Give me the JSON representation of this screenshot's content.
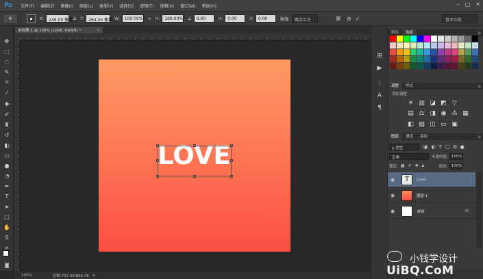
{
  "app": {
    "logo": "Ps"
  },
  "menu": [
    "文件(F)",
    "编辑(E)",
    "图像(I)",
    "图层(L)",
    "类型(Y)",
    "选择(S)",
    "滤镜(T)",
    "视图(V)",
    "窗口(W)",
    "帮助(H)"
  ],
  "window_controls": [
    "–",
    "□",
    "✕"
  ],
  "options": {
    "x_label": "X:",
    "x_value": "249.00 像素",
    "y_label": "Y:",
    "y_value": "264.45 像素",
    "w_label": "W:",
    "w_value": "100.00%",
    "h_label": "H:",
    "h_value": "100.00%",
    "angle_value": "0.00",
    "hskew_label": "H:",
    "hskew_value": "0.00",
    "vskew_label": "V:",
    "vskew_value": "0.00",
    "interp_label": "插值:",
    "interp_value": "两次立方",
    "workspace": "基本功能"
  },
  "document": {
    "tab_title": "未标题-1 @ 100% (LOVE, RGB/8) *",
    "tab_close": "×"
  },
  "canvas": {
    "text": "LOVE"
  },
  "status": {
    "zoom": "100%",
    "doc_info": "文档:732.4K/865.4K"
  },
  "panels": {
    "color_tabs": [
      "颜色",
      "色板"
    ],
    "adjust_tabs": [
      "调整",
      "样式"
    ],
    "adjust_label": "添加调整",
    "layer_tabs": [
      "图层",
      "通道",
      "路径"
    ],
    "kind_select": "ρ 类型",
    "blend_mode": "正常",
    "opacity_label": "不透明度:",
    "opacity_value": "100%",
    "lock_label": "锁定:",
    "fill_label": "填充:",
    "fill_value": "100%",
    "layers": [
      {
        "name": "Love",
        "thumb": "T",
        "selected": true
      },
      {
        "name": "图层 1",
        "thumb": "",
        "selected": false
      },
      {
        "name": "背景",
        "thumb": "",
        "selected": false
      }
    ]
  },
  "swatch_colors": [
    "#ff0000",
    "#ffff00",
    "#00ff00",
    "#00ffff",
    "#0000ff",
    "#ff00ff",
    "#ffffff",
    "#e6e6e6",
    "#cccccc",
    "#b3b3b3",
    "#999999",
    "#666666",
    "#000000",
    "#f4c6c6",
    "#f7e2b5",
    "#fff5b5",
    "#d8f0b5",
    "#b8e6d2",
    "#b5dff2",
    "#b8c8ec",
    "#cdb8e8",
    "#e8b8d8",
    "#f0b8c0",
    "#e8e8c0",
    "#c0e8c8",
    "#c8d8e8",
    "#e84c3d",
    "#f39c12",
    "#f1c40f",
    "#2ecc71",
    "#1abc9c",
    "#3498db",
    "#2c4fa8",
    "#8e44ad",
    "#c0398a",
    "#e0447a",
    "#b8a24a",
    "#5aa05a",
    "#3f6fb5",
    "#a32b22",
    "#b8660a",
    "#b39d0a",
    "#1e8a49",
    "#128a72",
    "#1f6ea5",
    "#1a2f78",
    "#5e2b78",
    "#8a1f5e",
    "#a01f4a",
    "#7a6a2a",
    "#2f6a2f",
    "#1f4a7a",
    "#6a1a14",
    "#7a4206",
    "#6e5f06",
    "#12572d",
    "#0c5a4a",
    "#143f62",
    "#101c4a",
    "#3a1a4a",
    "#56133a",
    "#63132d",
    "#4a401a",
    "#1c401c",
    "#132d4a"
  ],
  "watermark": {
    "brand": "小钱学设计",
    "url": "UiBQ.CoM"
  }
}
